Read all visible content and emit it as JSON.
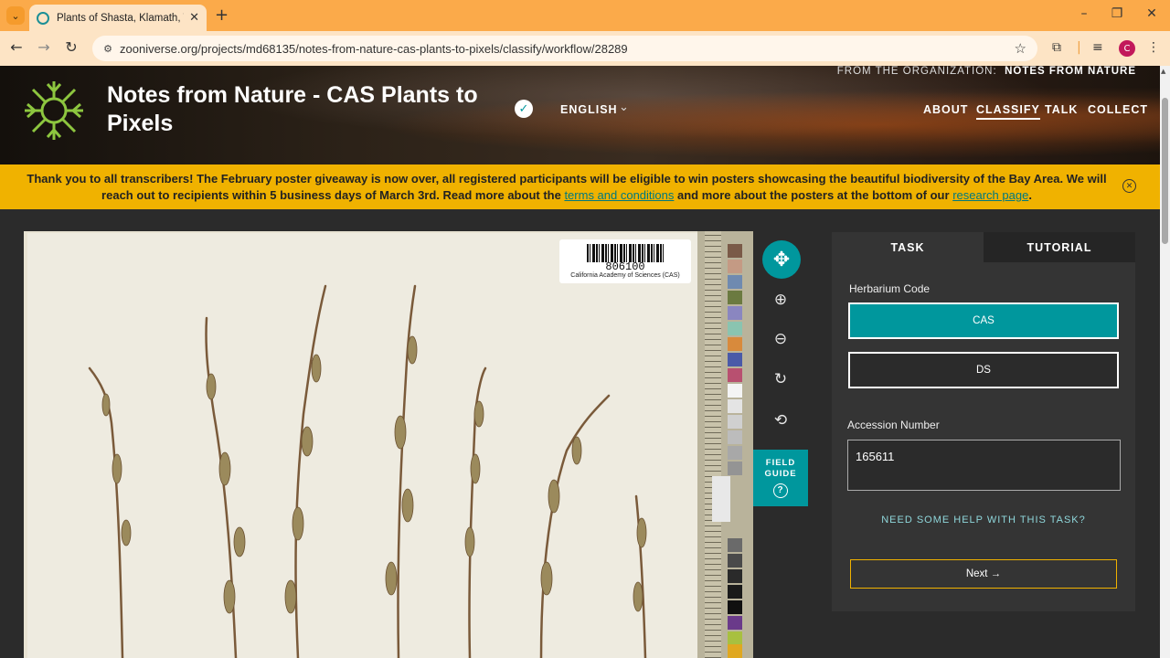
{
  "browser": {
    "tab_title": "Plants of Shasta, Klamath, Trinit",
    "url": "zooniverse.org/projects/md68135/notes-from-nature-cas-plants-to-pixels/classify/workflow/28289",
    "profile_initial": "C"
  },
  "header": {
    "project_title": "Notes from Nature - CAS Plants to Pixels",
    "language": "ENGLISH",
    "org_prefix": "FROM THE ORGANIZATION:",
    "org_name": "NOTES FROM NATURE",
    "nav": {
      "about": "ABOUT",
      "classify": "CLASSIFY",
      "talk": "TALK",
      "collect": "COLLECT"
    }
  },
  "banner": {
    "text_1": "Thank you to all transcribers! The February poster giveaway is now over, all registered participants will be eligible to win posters showcasing the beautiful biodiversity of the Bay Area. We will reach out to recipients within 5 business days of March 3rd. Read more about the ",
    "link_1": "terms and conditions",
    "text_2": " and more about the posters at the bottom of our ",
    "link_2": "research page",
    "text_3": "."
  },
  "specimen": {
    "barcode_number": "806100",
    "institution": "California Academy of Sciences (CAS)"
  },
  "tools": {
    "field_guide_line1": "FIELD",
    "field_guide_line2": "GUIDE"
  },
  "task_panel": {
    "tab_task": "TASK",
    "tab_tutorial": "TUTORIAL",
    "q1_label": "Herbarium Code",
    "q1_options": [
      "CAS",
      "DS"
    ],
    "q1_selected": "CAS",
    "q2_label": "Accession Number",
    "q2_value": "165611",
    "help_text": "NEED SOME HELP WITH THIS TASK?",
    "next_label": "Next →"
  },
  "colors": {
    "accent_teal": "#00979d",
    "banner_yellow": "#f0b200",
    "browser_orange": "#fbaa4a",
    "logo_green": "#8dc63f"
  },
  "icons": {
    "verified": "check-badge-icon",
    "move": "move-arrows-icon",
    "zoom_in": "zoom-in-icon",
    "zoom_out": "zoom-out-icon",
    "rotate": "rotate-icon",
    "reset": "reset-icon",
    "help": "question-circle-icon"
  }
}
